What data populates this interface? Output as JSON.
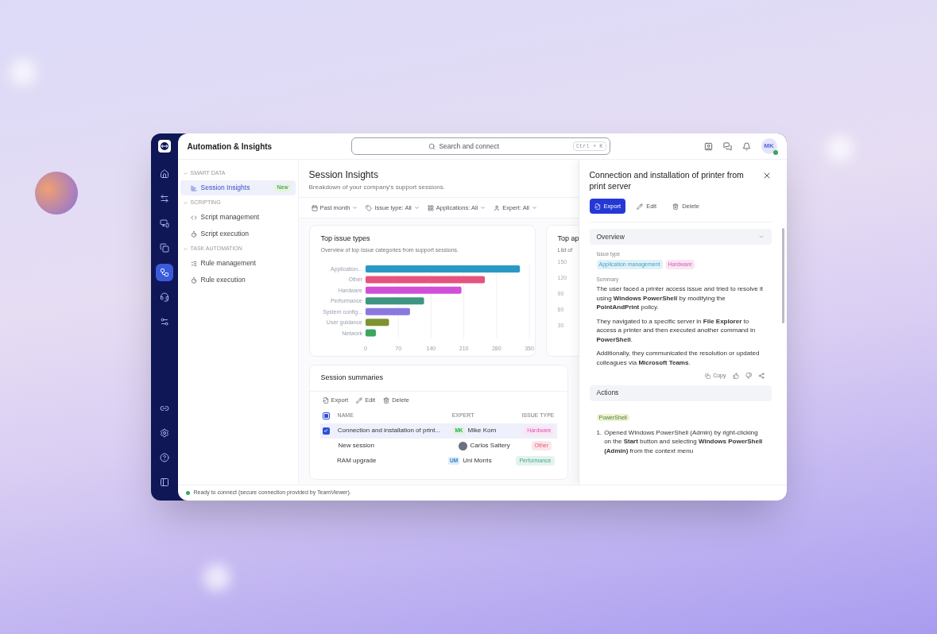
{
  "rail": {
    "top": [
      {
        "selected": false
      },
      {
        "selected": false
      },
      {
        "selected": false
      },
      {
        "selected": false
      },
      {
        "selected": true
      },
      {
        "selected": false
      },
      {
        "selected": false
      }
    ],
    "bottom": [
      {
        "selected": false
      },
      {
        "selected": false
      },
      {
        "selected": false
      },
      {
        "selected": false
      }
    ]
  },
  "header": {
    "title": "Automation & Insights",
    "search": {
      "placeholder": "Search and connect",
      "shortcut": "Ctrl + K"
    },
    "avatar": {
      "initials": "MK",
      "online": true
    }
  },
  "nav": [
    {
      "label": "SMART DATA",
      "expanded": true,
      "items": [
        {
          "label": "Session Insights",
          "selected": true,
          "badge": "New"
        }
      ]
    },
    {
      "label": "SCRIPTING",
      "expanded": true,
      "items": [
        {
          "label": "Script management",
          "selected": false
        },
        {
          "label": "Script execution",
          "selected": false
        }
      ]
    },
    {
      "label": "TASK AUTOMATION",
      "expanded": true,
      "items": [
        {
          "label": "Rule management",
          "selected": false
        },
        {
          "label": "Rule execution",
          "selected": false
        }
      ]
    }
  ],
  "page": {
    "title": "Session Insights",
    "subtitle": "Breakdown of your company's support sessions.",
    "filters": [
      "Past month",
      "Issue type: All",
      "Applications: All",
      "Expert: All"
    ]
  },
  "issue_chart": {
    "title": "Top issue types",
    "subtitle": "Overview of top issue categories from support sessions.",
    "chart_data": {
      "type": "bar",
      "orientation": "horizontal",
      "grid": true,
      "categories": [
        "Application...",
        "Other",
        "Hardware",
        "Performance",
        "System config...",
        "User guidance",
        "Network"
      ],
      "series": [
        {
          "color": "#2a98c4",
          "values": [
            330,
            null,
            null,
            null,
            null,
            null,
            null
          ]
        },
        {
          "color": "#e5537f",
          "values": [
            null,
            255,
            null,
            null,
            null,
            null,
            null
          ]
        },
        {
          "color": "#d24fd9",
          "values": [
            null,
            null,
            205,
            null,
            null,
            null,
            null
          ]
        },
        {
          "color": "#3f9680",
          "values": [
            null,
            null,
            null,
            125,
            null,
            null,
            null
          ]
        },
        {
          "color": "#8a78e0",
          "values": [
            null,
            null,
            null,
            null,
            95,
            null,
            null
          ]
        },
        {
          "color": "#7d9330",
          "values": [
            null,
            null,
            null,
            null,
            null,
            50,
            null
          ]
        },
        {
          "color": "#3ba55c",
          "values": [
            null,
            null,
            null,
            null,
            null,
            null,
            22
          ]
        }
      ],
      "xlim": [
        0,
        350
      ],
      "xticks": [
        0,
        70,
        140,
        210,
        280,
        350
      ]
    }
  },
  "apps_card": {
    "title": "Top ap",
    "subtitle": "List of",
    "axis_labels": [
      "150",
      "120",
      "90",
      "60",
      "30"
    ]
  },
  "summaries": {
    "title": "Session summaries",
    "actions": [
      "Export",
      "Edit",
      "Delete"
    ],
    "columns": [
      "NAME",
      "EXPERT",
      "ISSUE TYPE"
    ],
    "header_checkbox_indeterminate": true,
    "rows": [
      {
        "name": "Connection and installation of print...",
        "expert": "Mike Korn",
        "photo": false,
        "initials": "MK",
        "color": "#e0f3e4",
        "tag": {
          "label": "Hardware",
          "color": "#f9e6f4"
        },
        "selected": true
      },
      {
        "name": "New session",
        "expert": "Carlos Saltery",
        "photo": true,
        "tag": {
          "label": "Other",
          "color": "#fbe6ea"
        },
        "selected": false
      },
      {
        "name": "RAM upgrade",
        "expert": "Uni Morris",
        "photo": false,
        "initials": "UM",
        "color": "#e0ecf8",
        "tag": {
          "label": "Performance",
          "color": "#e3f2ee"
        },
        "selected": false
      }
    ]
  },
  "panel": {
    "title": "Connection and installation of printer from print server",
    "buttons": [
      {
        "label": "Export",
        "primary": true
      },
      {
        "label": "Edit",
        "primary": false
      },
      {
        "label": "Delete",
        "primary": false
      }
    ],
    "overview": {
      "label": "Overview",
      "expanded": true,
      "issue_label": "Issue type",
      "tags": [
        {
          "label": "Application management",
          "color": "#e2f1f7"
        },
        {
          "label": "Hardware",
          "color": "#f9e6f4"
        }
      ],
      "summary_label": "Summary",
      "paragraphs": [
        "The user faced a printer access issue and tried to resolve it using **Windows PowerShell** by modifying the **PointAndPrint** policy.",
        "They navigated to a specific server in **File Explorer** to access a printer and then executed another command in **PowerShell**.",
        "Additionally, they communicated the resolution or updated colleagues via **Microsoft Teams**."
      ],
      "copy": "Copy"
    },
    "actions": {
      "label": "Actions",
      "tag": "PowerShell",
      "steps": [
        {
          "number": "1.",
          "text": "Opened Windows PowerShell (Admin) by right-clicking on the **Start** button and selecting **Windows PowerShell (Admin)** from the context menu"
        }
      ]
    }
  },
  "status": {
    "online": true,
    "text": "Ready to connect (secure connection provided by TeamViewer)."
  }
}
